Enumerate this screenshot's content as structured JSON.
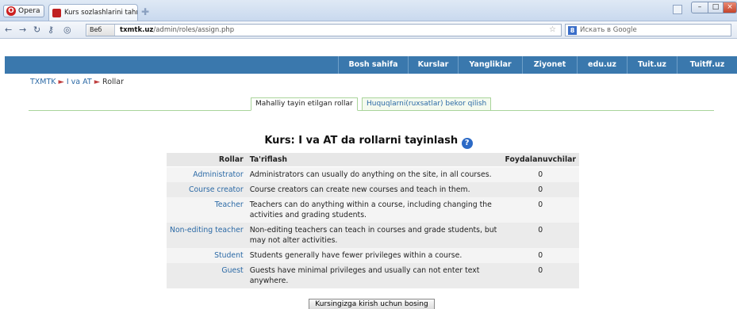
{
  "browser": {
    "opera_label": "Opera",
    "tab_title": "Kurs sozlashlarini tahrir...",
    "url_prefix": "Веб",
    "url_domain": "txmtk.uz",
    "url_path": "/admin/roles/assign.php",
    "search_placeholder": "Искать в Google",
    "window_buttons": {
      "minimize": "–",
      "maximize": "□",
      "close": "×"
    }
  },
  "nav": {
    "items": [
      "Bosh sahifa",
      "Kurslar",
      "Yangliklar",
      "Ziyonet",
      "edu.uz",
      "Tuit.uz",
      "Tuitff.uz"
    ]
  },
  "breadcrumb": {
    "items": [
      "TXMTK",
      "I va AT",
      "Rollar"
    ],
    "separator": "►"
  },
  "subtabs": {
    "active": "Mahalliy tayin etilgan rollar",
    "inactive": "Huquqlarni(ruxsatlar) bekor qilish"
  },
  "heading": "Kurs: I va AT da rollarni tayinlash",
  "table": {
    "headers": {
      "role": "Rollar",
      "desc": "Ta'riflash",
      "users": "Foydalanuvchilar"
    },
    "rows": [
      {
        "role": "Administrator",
        "desc": "Administrators can usually do anything on the site, in all courses.",
        "users": "0"
      },
      {
        "role": "Course creator",
        "desc": "Course creators can create new courses and teach in them.",
        "users": "0"
      },
      {
        "role": "Teacher",
        "desc": "Teachers can do anything within a course, including changing the activities and grading students.",
        "users": "0"
      },
      {
        "role": "Non-editing teacher",
        "desc": "Non-editing teachers can teach in courses and grade students, but may not alter activities.",
        "users": "0"
      },
      {
        "role": "Student",
        "desc": "Students generally have fewer privileges within a course.",
        "users": "0"
      },
      {
        "role": "Guest",
        "desc": "Guests have minimal privileges and usually can not enter text anywhere.",
        "users": "0"
      }
    ]
  },
  "submit_label": "Kursingizga kirish uchun bosing",
  "colors": {
    "navbar": "#3a78ad",
    "link": "#2c6aa6",
    "tab_border": "#a9d49a"
  }
}
